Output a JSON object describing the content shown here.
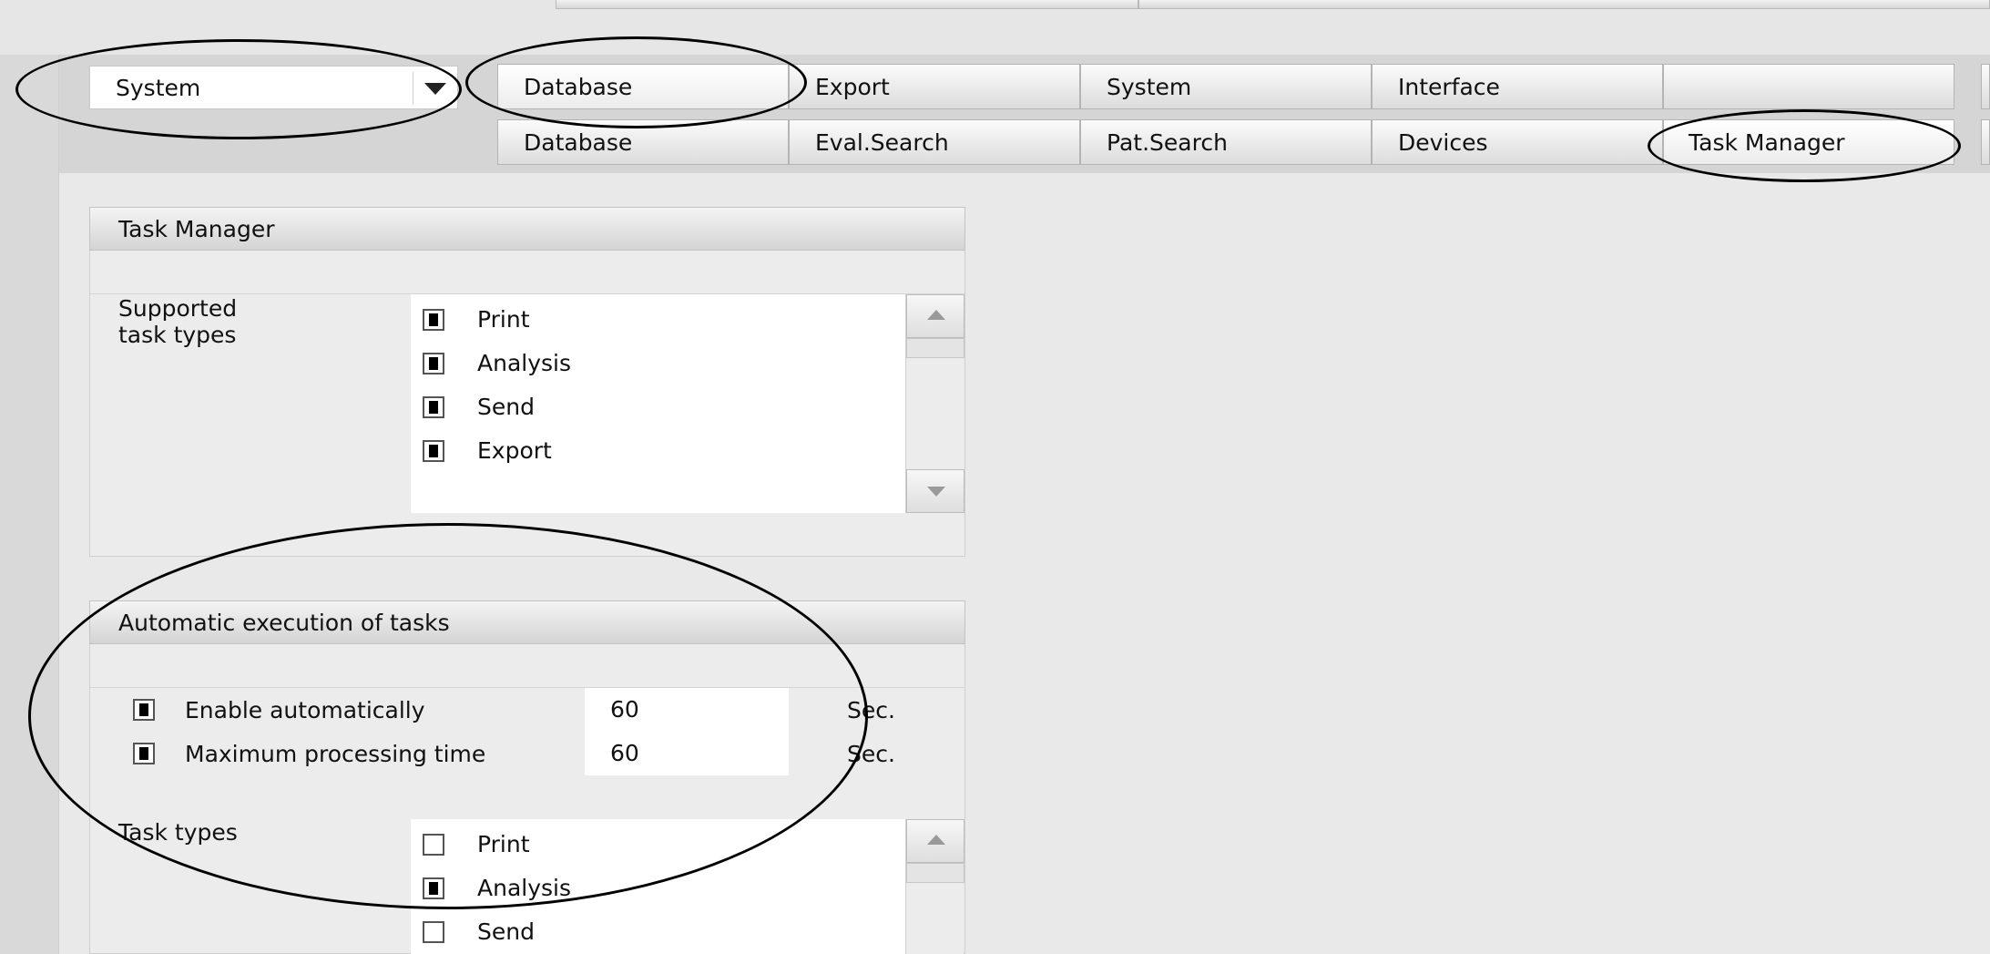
{
  "dropdown": {
    "selected": "System"
  },
  "tabs_row1": [
    {
      "label": "Database"
    },
    {
      "label": "Export"
    },
    {
      "label": "System"
    },
    {
      "label": "Interface"
    },
    {
      "label": ""
    }
  ],
  "tabs_row2": [
    {
      "label": "Database"
    },
    {
      "label": "Eval.Search"
    },
    {
      "label": "Pat.Search"
    },
    {
      "label": "Devices"
    },
    {
      "label": "Task Manager"
    }
  ],
  "task_manager": {
    "header": "Task Manager",
    "supported_label_line1": "Supported",
    "supported_label_line2": "task types",
    "items": [
      {
        "label": "Print",
        "checked": true
      },
      {
        "label": "Analysis",
        "checked": true
      },
      {
        "label": "Send",
        "checked": true
      },
      {
        "label": "Export",
        "checked": true
      }
    ]
  },
  "auto_exec": {
    "header": "Automatic execution of tasks",
    "enable_label": "Enable automatically",
    "enable_checked": true,
    "enable_value": "60",
    "enable_unit": "Sec.",
    "max_label": "Maximum processing time",
    "max_checked": true,
    "max_value": "60",
    "max_unit": "Sec.",
    "task_types_label": "Task types",
    "items": [
      {
        "label": "Print",
        "checked": false
      },
      {
        "label": "Analysis",
        "checked": true
      },
      {
        "label": "Send",
        "checked": false
      }
    ]
  },
  "colors": {
    "background": "#e9e9e9",
    "tab_band": "#d5d5d5",
    "annotation": "#000000"
  }
}
